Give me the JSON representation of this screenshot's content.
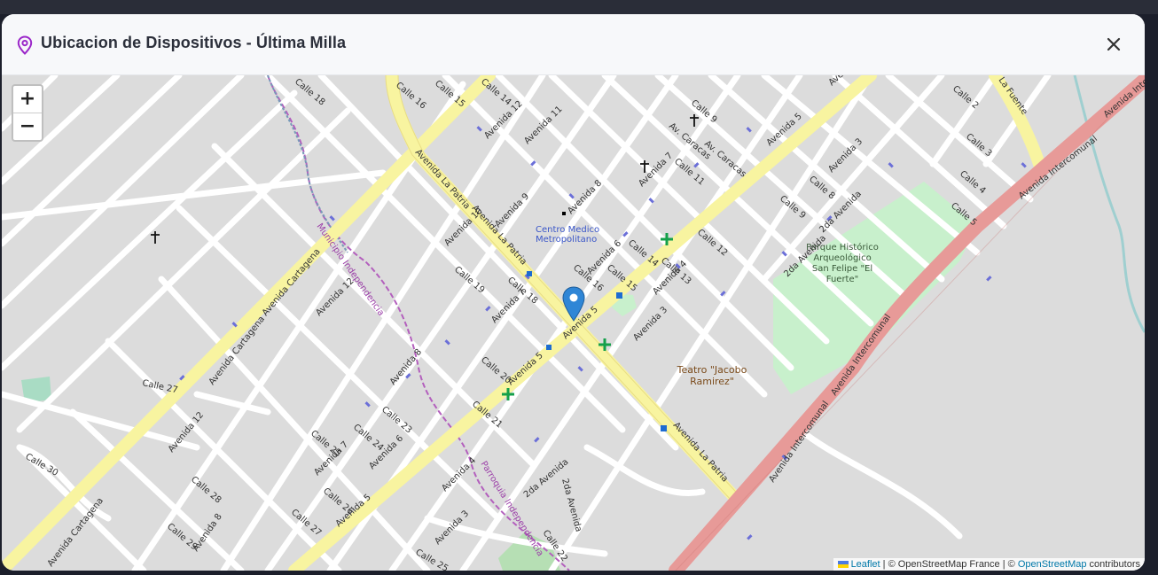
{
  "modal": {
    "title": "Ubicacion de Dispositivos -  Última Milla",
    "title_icon": "map-pin-icon",
    "close_icon": "close-icon"
  },
  "map": {
    "zoom_in_label": "+",
    "zoom_out_label": "−",
    "marker_icon": "map-marker-icon",
    "labels": {
      "centro_medico": [
        "Centro Medico",
        "Metropolitano"
      ],
      "parque": [
        "Parque Histórico",
        "Arqueológico",
        "San Felipe \"El",
        "Fuerte\""
      ],
      "teatro": [
        "Teatro \"Jacobo",
        "Ramirez\""
      ],
      "municipio": "Municipio Independencia",
      "parroquia": "Parroquia Independencia",
      "av_la_patria_1": "Avenida La Patria",
      "av_la_patria_2": "Avenida La Patria",
      "av_la_patria_3": "Avenida La Patria",
      "av_cartagena_1": "Avenida Cartagena",
      "av_cartagena_2": "Avenida Cartagena",
      "av_cartagena_3": "Avenida Cartagena",
      "av_intercomunal_1": "Avenida Intercomunal",
      "av_intercomunal_2": "Avenida Intercomunal",
      "av_intercomunal_3": "Avenida Intercomunal",
      "av_intercomunal_4": "Avenida Intercomunal",
      "av_5_a": "Avenida 5",
      "av_5_b": "Avenida 5",
      "av_5_c": "Avenida 5",
      "av_5_d": "Avenida 5",
      "av_5_e": "Avenida 5",
      "calle_18": "Calle 18",
      "calle_16": "Calle 16",
      "calle_15": "Calle 15",
      "calle_14": "Calle 14",
      "avenida_12": "Avenida 12",
      "avenida_11": "Avenida 11",
      "calle_9": "Calle 9",
      "av_caracas": "Av. Caracas",
      "av_caracas_2": "Av. Caracas",
      "avenida_9": "Avenida 9",
      "avenida_8": "Avenida 8",
      "avenida_7": "Avenida 7",
      "calle_11": "Calle 11",
      "avenida_10": "Avenida 10",
      "calle_19": "Calle 19",
      "calle_18b": "Calle 18",
      "avenida_7b": "Avenida 7",
      "calle_16b": "Calle 16",
      "calle_15b": "Calle 15",
      "avenida_6": "Avenida 6",
      "calle_14b": "Calle 14",
      "calle_12": "Calle 12",
      "calle_13": "Calle 13",
      "avenida_4": "Avenida 4",
      "avenida_3": "Avenida 3",
      "avenida_3b": "Avenida 3",
      "avenida_3c": "Avenida 3",
      "calle_8": "Calle 8",
      "calle_9b": "Calle 9",
      "calle_2": "Calle 2",
      "calle_3": "Calle 3",
      "calle_4": "Calle 4",
      "calle_5": "Calle 5",
      "la_fuente": "La Fuente",
      "segunda_av_1": "2da Avenida",
      "segunda_av_2": "2da Avenida",
      "segunda_av_3": "2da Avenida",
      "segunda_av_4": "2da Avenida",
      "avenida_12b": "Avenida 12",
      "avenida_8b": "Avenida 8",
      "calle_20": "Calle 20",
      "calle_21": "Calle 21",
      "calle_23": "Calle 23",
      "calle_24": "Calle 24",
      "calle_25": "Calle 25",
      "calle_25b": "Calle 25",
      "calle_26": "Calle 26",
      "calle_27": "Calle 27",
      "calle_27b": "Calle 27",
      "calle_28": "Calle 28",
      "calle_29": "Calle 29",
      "calle_30": "Calle 30",
      "calle_22": "Calle 22",
      "avenida_12c": "Avenida 12",
      "avenida_8c": "Avenida 8",
      "avenida_7c": "Avenida 7",
      "avenida_6b": "Avenida 6",
      "avenida_4b": "Avenida 4",
      "avenida_3d": "Avenida 3"
    }
  },
  "attribution": {
    "leaflet": "Leaflet",
    "sep1": " | © OpenStreetMap France | © ",
    "osm": "OpenStreetMap",
    "contributors": " contributors"
  },
  "colors": {
    "accent": "#9b27c9",
    "major_road": "#f8f4a0",
    "highway": "#e79a98",
    "park": "#c8f0cc",
    "marker": "#2f86d6"
  }
}
